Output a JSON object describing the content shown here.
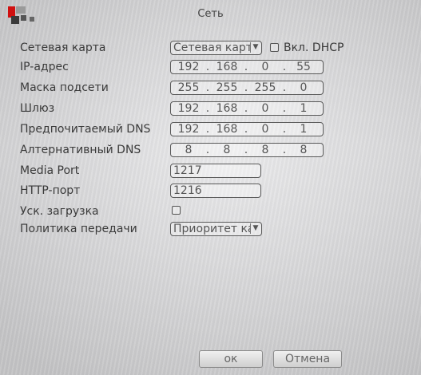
{
  "window": {
    "title": "Сеть"
  },
  "form": {
    "nic": {
      "label": "Сетевая карта",
      "value": "Сетевая карта"
    },
    "dhcp": {
      "label": "Вкл. DHCP",
      "checked": false
    },
    "ip": {
      "label": "IP-адрес",
      "octets": [
        "192",
        "168",
        "0",
        "55"
      ]
    },
    "mask": {
      "label": "Маска подсети",
      "octets": [
        "255",
        "255",
        "255",
        "0"
      ]
    },
    "gateway": {
      "label": "Шлюз",
      "octets": [
        "192",
        "168",
        "0",
        "1"
      ]
    },
    "dns1": {
      "label": "Предпочитаемый DNS",
      "octets": [
        "192",
        "168",
        "0",
        "1"
      ]
    },
    "dns2": {
      "label": "Алтернативный DNS",
      "octets": [
        "8",
        "8",
        "8",
        "8"
      ]
    },
    "media_port": {
      "label": "Media Port",
      "value": "1217"
    },
    "http_port": {
      "label": "HTTP-порт",
      "value": "1216"
    },
    "fast_download": {
      "label": "Уск. загрузка",
      "checked": false
    },
    "policy": {
      "label": "Политика передачи",
      "value": "Приоритет качества"
    }
  },
  "buttons": {
    "ok": "ок",
    "cancel": "Отмена"
  },
  "icons": {
    "logo": "app-logo-icon",
    "dropdown": "chevron-down-icon"
  },
  "colors": {
    "background": "#dfdfe1",
    "border": "#5a5a5a",
    "logo_red": "#d01010"
  }
}
